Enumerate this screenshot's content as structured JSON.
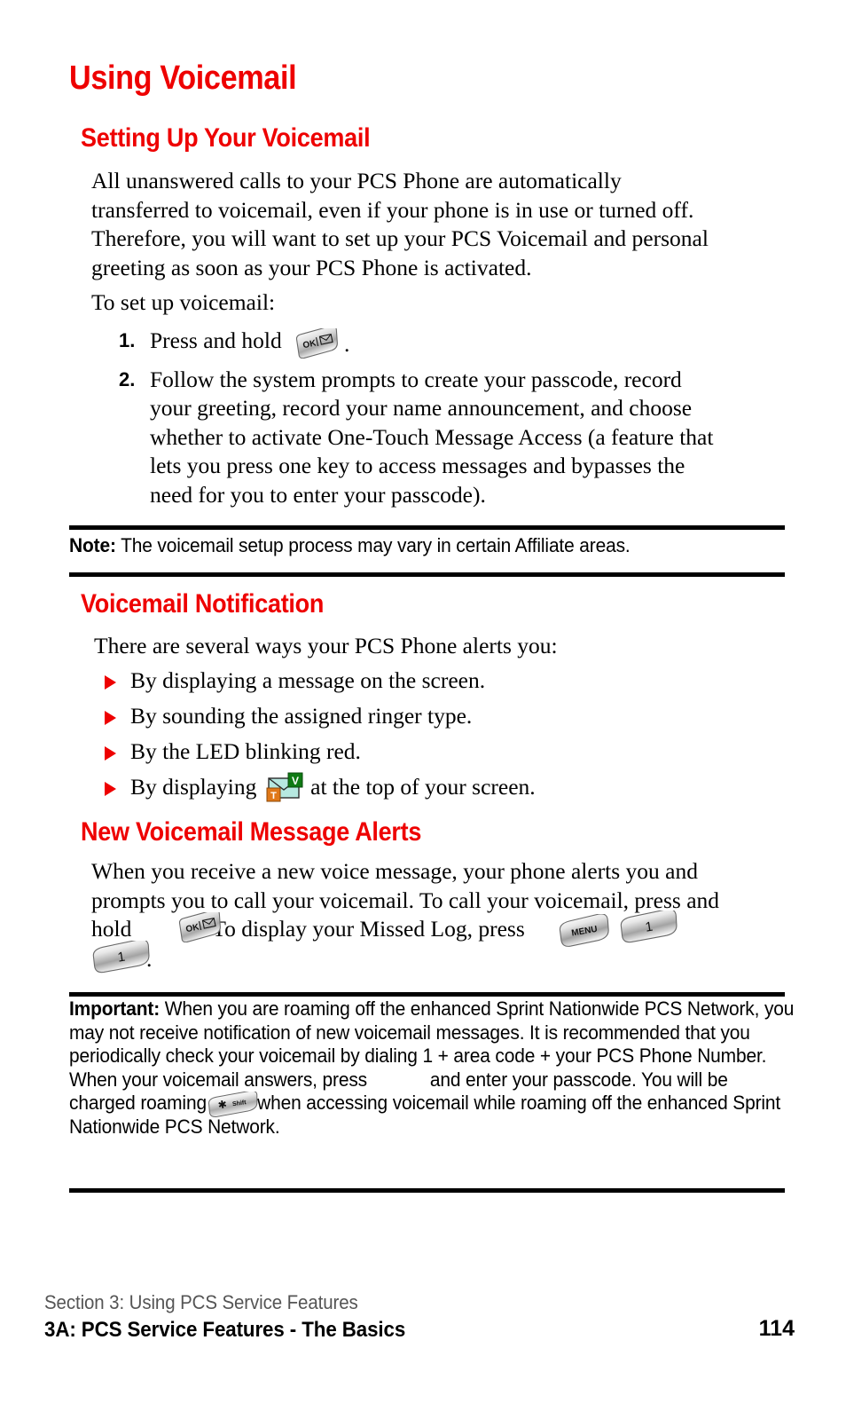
{
  "page": {
    "title": "Using Voicemail",
    "accent_color": "#ee0000",
    "page_number": "114"
  },
  "sections": {
    "setting_up": {
      "heading": "Setting Up Your Voicemail",
      "intro": "All unanswered calls to your PCS Phone are automatically transferred to voicemail, even if your phone is in use or turned off. Therefore, you will want to set up your PCS Voicemail and personal greeting as soon as your PCS Phone is activated.",
      "lead_in": "To set up voicemail:",
      "steps": [
        {
          "number": "1.",
          "text_before": "Press and hold",
          "key": "ok-message-key",
          "text_after": "."
        },
        {
          "number": "2.",
          "text_before": "Follow the system prompts to create your passcode, record your greeting, record your name announcement, and choose whether to activate One-Touch Message Access (a feature that lets you press one key to access messages and bypasses the need for you to enter your passcode).",
          "key": "",
          "text_after": ""
        }
      ]
    },
    "note": {
      "label": "Note:",
      "text": "The voicemail setup process may vary in certain Affiliate areas."
    },
    "notification": {
      "heading": "Voicemail Notification",
      "lead_in": "There are several ways your PCS Phone alerts you:",
      "bullets": [
        {
          "text_before": "By displaying a message on the screen.",
          "icon": "",
          "text_after": ""
        },
        {
          "text_before": "By sounding the assigned ringer type.",
          "icon": "",
          "text_after": ""
        },
        {
          "text_before": "By the LED blinking red.",
          "icon": "",
          "text_after": ""
        },
        {
          "text_before": "By displaying",
          "icon": "voicemail-envelope-icon",
          "text_after": "at the top of your screen."
        }
      ]
    },
    "alerts": {
      "heading": "New Voicemail Message Alerts",
      "text_part1": "When you receive a new voice message, your phone alerts you and prompts you to call your voicemail. To call your voicemail, press and hold",
      "text_part2": ". To display your Missed Log, press",
      "text_part3": "."
    },
    "important": {
      "label": "Important:",
      "text_part1": "When you are roaming off the enhanced Sprint Nationwide PCS Network, you may not receive notification of new voicemail messages. It is recommended that you periodically check your voicemail by dialing 1 + area code + your PCS Phone Number. When your voicemail answers, press",
      "text_part2": "and enter your passcode. You will be charged roaming rates when accessing voicemail while roaming off the enhanced Sprint Nationwide PCS Network."
    }
  },
  "keys": {
    "ok_message": {
      "name": "ok-message-key",
      "label": "OK",
      "glyph": "envelope"
    },
    "menu": {
      "name": "menu-key",
      "label": "MENU"
    },
    "one": {
      "name": "number-one-key",
      "label": "1"
    },
    "shift_star": {
      "name": "star-shift-key",
      "label": "Shift",
      "glyph": "asterisk"
    }
  },
  "status_icon": {
    "name": "voicemail-envelope-icon",
    "badge_top": "V",
    "badge_bottom": "T",
    "envelope_color": "#b6e8e0",
    "badge_top_color": "#0f7a14",
    "badge_bottom_color": "#e07818"
  },
  "footer": {
    "section_line": "Section 3: Using PCS Service Features",
    "chapter_line": "3A: PCS Service Features - The Basics",
    "page_number": "114"
  }
}
